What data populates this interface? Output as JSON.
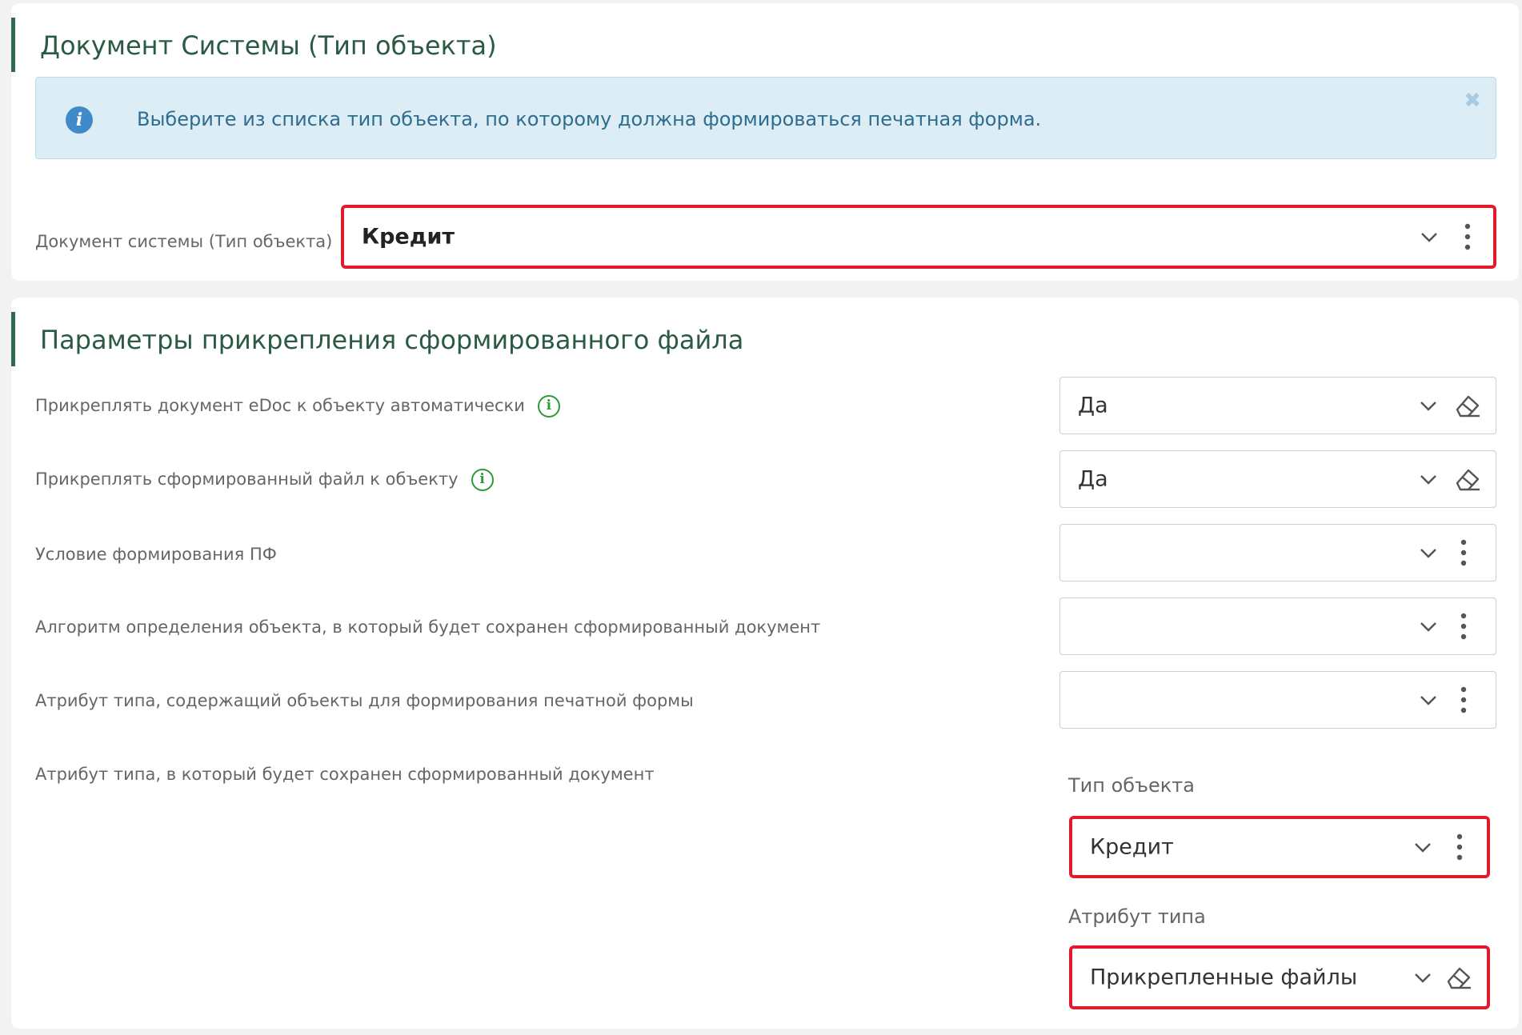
{
  "section1": {
    "title": "Документ Системы (Тип объекта)",
    "alert_text": "Выберите из списка тип объекта, по которому должна формироваться печатная форма.",
    "alert_close": "✖",
    "field_label": "Документ системы (Тип объекта)",
    "field_value": "Кредит"
  },
  "section2": {
    "title": "Параметры прикрепления сформированного файла",
    "rows": [
      {
        "label": "Прикреплять документ eDoc к объекту автоматически",
        "value": "Да"
      },
      {
        "label": "Прикреплять сформированный файл к объекту",
        "value": "Да"
      },
      {
        "label": "Условие формирования ПФ",
        "value": ""
      },
      {
        "label": "Алгоритм определения объекта, в который будет сохранен сформированный документ",
        "value": ""
      },
      {
        "label": "Атрибут типа, содержащий объекты для формирования печатной формы",
        "value": ""
      },
      {
        "label": "Атрибут типа, в который будет сохранен сформированный документ"
      }
    ],
    "object_type_label": "Тип объекта",
    "object_type_value": "Кредит",
    "type_attribute_label": "Атрибут типа",
    "type_attribute_value": "Прикрепленные файлы"
  },
  "icons": {
    "info": "info-icon",
    "chevron": "chevron-down-icon",
    "kebab": "more-vertical-icon",
    "eraser": "eraser-icon",
    "close": "close-icon"
  },
  "colors": {
    "accent_green": "#2b5a44",
    "alert_bg": "#dcedf5",
    "highlight_red": "#e21a2e",
    "info_green": "#2e9a3a"
  }
}
